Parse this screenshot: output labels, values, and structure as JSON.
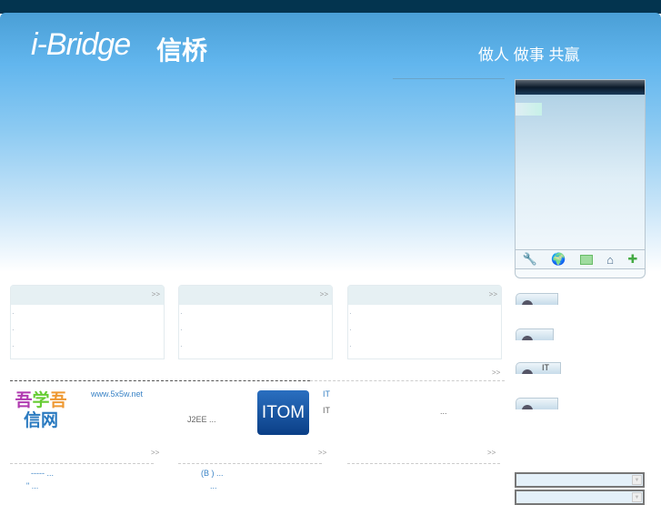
{
  "header": {
    "logo": "i-Bridge",
    "logo_cn": "信桥",
    "slogan": "做人 做事 共赢"
  },
  "panel": {
    "icons": [
      "wrench-icon",
      "globe-icon",
      "card-icon",
      "home-icon",
      "puzzle-icon"
    ]
  },
  "boxes": [
    {
      "more": ">>"
    },
    {
      "more": ">>"
    },
    {
      "more": ">>"
    }
  ],
  "section": {
    "more": ">>"
  },
  "featured": {
    "site_url": "www.5x5w.net",
    "j2ee_text": "J2EE ...",
    "itom_logo": "ITOM",
    "it_line1": "IT",
    "it_line2": "IT",
    "ellipsis": "..."
  },
  "lists": [
    {
      "more": ">>",
      "items": [
        "----- ...",
        "\" ..."
      ]
    },
    {
      "more": ">>",
      "items": [
        "(B ) ...",
        "..."
      ]
    },
    {
      "more": ">>",
      "items": []
    }
  ],
  "right_tabs": [
    "",
    "",
    "IT",
    ""
  ]
}
